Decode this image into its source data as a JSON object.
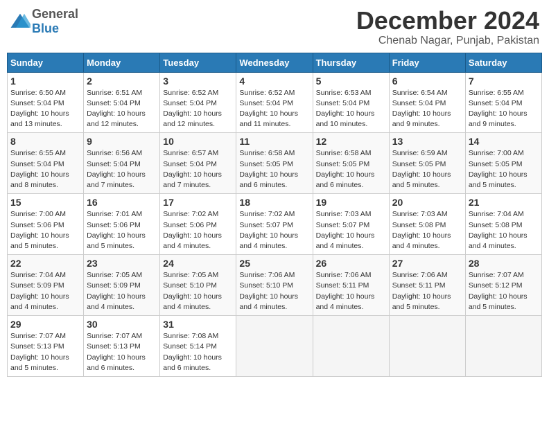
{
  "header": {
    "logo_general": "General",
    "logo_blue": "Blue",
    "title": "December 2024",
    "location": "Chenab Nagar, Punjab, Pakistan"
  },
  "weekdays": [
    "Sunday",
    "Monday",
    "Tuesday",
    "Wednesday",
    "Thursday",
    "Friday",
    "Saturday"
  ],
  "weeks": [
    [
      {
        "day": "1",
        "sunrise": "6:50 AM",
        "sunset": "5:04 PM",
        "daylight": "10 hours and 13 minutes."
      },
      {
        "day": "2",
        "sunrise": "6:51 AM",
        "sunset": "5:04 PM",
        "daylight": "10 hours and 12 minutes."
      },
      {
        "day": "3",
        "sunrise": "6:52 AM",
        "sunset": "5:04 PM",
        "daylight": "10 hours and 12 minutes."
      },
      {
        "day": "4",
        "sunrise": "6:52 AM",
        "sunset": "5:04 PM",
        "daylight": "10 hours and 11 minutes."
      },
      {
        "day": "5",
        "sunrise": "6:53 AM",
        "sunset": "5:04 PM",
        "daylight": "10 hours and 10 minutes."
      },
      {
        "day": "6",
        "sunrise": "6:54 AM",
        "sunset": "5:04 PM",
        "daylight": "10 hours and 9 minutes."
      },
      {
        "day": "7",
        "sunrise": "6:55 AM",
        "sunset": "5:04 PM",
        "daylight": "10 hours and 9 minutes."
      }
    ],
    [
      {
        "day": "8",
        "sunrise": "6:55 AM",
        "sunset": "5:04 PM",
        "daylight": "10 hours and 8 minutes."
      },
      {
        "day": "9",
        "sunrise": "6:56 AM",
        "sunset": "5:04 PM",
        "daylight": "10 hours and 7 minutes."
      },
      {
        "day": "10",
        "sunrise": "6:57 AM",
        "sunset": "5:04 PM",
        "daylight": "10 hours and 7 minutes."
      },
      {
        "day": "11",
        "sunrise": "6:58 AM",
        "sunset": "5:05 PM",
        "daylight": "10 hours and 6 minutes."
      },
      {
        "day": "12",
        "sunrise": "6:58 AM",
        "sunset": "5:05 PM",
        "daylight": "10 hours and 6 minutes."
      },
      {
        "day": "13",
        "sunrise": "6:59 AM",
        "sunset": "5:05 PM",
        "daylight": "10 hours and 5 minutes."
      },
      {
        "day": "14",
        "sunrise": "7:00 AM",
        "sunset": "5:05 PM",
        "daylight": "10 hours and 5 minutes."
      }
    ],
    [
      {
        "day": "15",
        "sunrise": "7:00 AM",
        "sunset": "5:06 PM",
        "daylight": "10 hours and 5 minutes."
      },
      {
        "day": "16",
        "sunrise": "7:01 AM",
        "sunset": "5:06 PM",
        "daylight": "10 hours and 5 minutes."
      },
      {
        "day": "17",
        "sunrise": "7:02 AM",
        "sunset": "5:06 PM",
        "daylight": "10 hours and 4 minutes."
      },
      {
        "day": "18",
        "sunrise": "7:02 AM",
        "sunset": "5:07 PM",
        "daylight": "10 hours and 4 minutes."
      },
      {
        "day": "19",
        "sunrise": "7:03 AM",
        "sunset": "5:07 PM",
        "daylight": "10 hours and 4 minutes."
      },
      {
        "day": "20",
        "sunrise": "7:03 AM",
        "sunset": "5:08 PM",
        "daylight": "10 hours and 4 minutes."
      },
      {
        "day": "21",
        "sunrise": "7:04 AM",
        "sunset": "5:08 PM",
        "daylight": "10 hours and 4 minutes."
      }
    ],
    [
      {
        "day": "22",
        "sunrise": "7:04 AM",
        "sunset": "5:09 PM",
        "daylight": "10 hours and 4 minutes."
      },
      {
        "day": "23",
        "sunrise": "7:05 AM",
        "sunset": "5:09 PM",
        "daylight": "10 hours and 4 minutes."
      },
      {
        "day": "24",
        "sunrise": "7:05 AM",
        "sunset": "5:10 PM",
        "daylight": "10 hours and 4 minutes."
      },
      {
        "day": "25",
        "sunrise": "7:06 AM",
        "sunset": "5:10 PM",
        "daylight": "10 hours and 4 minutes."
      },
      {
        "day": "26",
        "sunrise": "7:06 AM",
        "sunset": "5:11 PM",
        "daylight": "10 hours and 4 minutes."
      },
      {
        "day": "27",
        "sunrise": "7:06 AM",
        "sunset": "5:11 PM",
        "daylight": "10 hours and 5 minutes."
      },
      {
        "day": "28",
        "sunrise": "7:07 AM",
        "sunset": "5:12 PM",
        "daylight": "10 hours and 5 minutes."
      }
    ],
    [
      {
        "day": "29",
        "sunrise": "7:07 AM",
        "sunset": "5:13 PM",
        "daylight": "10 hours and 5 minutes."
      },
      {
        "day": "30",
        "sunrise": "7:07 AM",
        "sunset": "5:13 PM",
        "daylight": "10 hours and 6 minutes."
      },
      {
        "day": "31",
        "sunrise": "7:08 AM",
        "sunset": "5:14 PM",
        "daylight": "10 hours and 6 minutes."
      },
      null,
      null,
      null,
      null
    ]
  ]
}
